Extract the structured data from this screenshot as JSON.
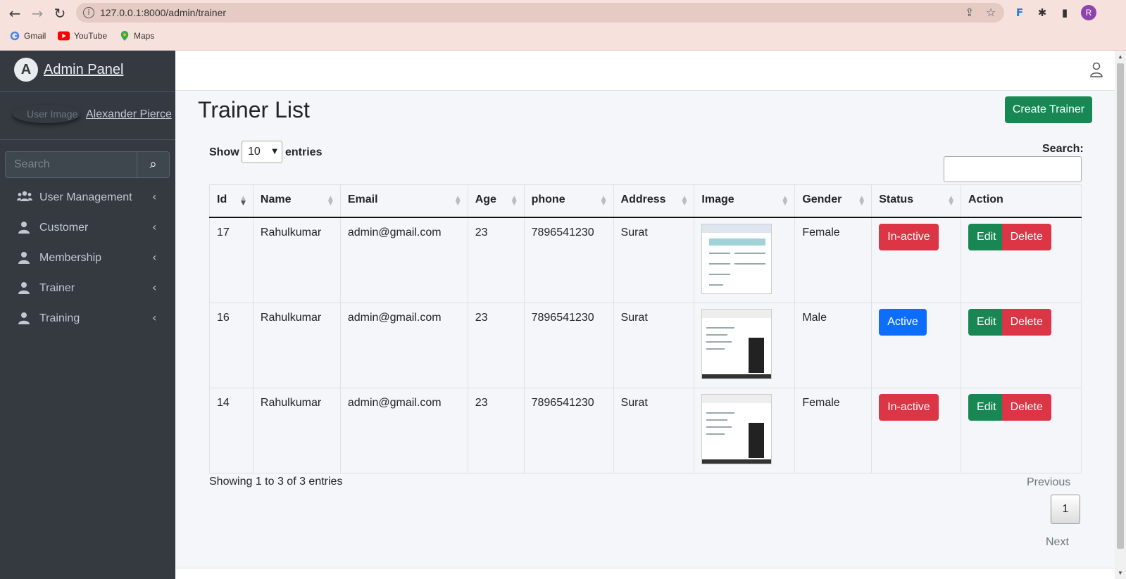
{
  "browser": {
    "url": "127.0.0.1:8000/admin/trainer",
    "profile_initial": "R",
    "bookmarks": [
      {
        "label": "Gmail",
        "icon": "google-icon"
      },
      {
        "label": "YouTube",
        "icon": "youtube-icon"
      },
      {
        "label": "Maps",
        "icon": "maps-icon"
      }
    ]
  },
  "sidebar": {
    "brand": "Admin Panel",
    "brand_logo": "A",
    "user_image_alt": "User Image",
    "user_name": "Alexander Pierce",
    "search_placeholder": "Search",
    "items": [
      {
        "label": "User Management",
        "icon": "users-icon"
      },
      {
        "label": "Customer",
        "icon": "user-icon"
      },
      {
        "label": "Membership",
        "icon": "user-icon"
      },
      {
        "label": "Trainer",
        "icon": "user-icon"
      },
      {
        "label": "Training",
        "icon": "user-icon"
      }
    ]
  },
  "main": {
    "title": "Trainer List",
    "create_button": "Create Trainer",
    "show_label": "Show",
    "length_value": "10",
    "entries_label": "entries",
    "search_label": "Search:",
    "columns": [
      "Id",
      "Name",
      "Email",
      "Age",
      "phone",
      "Address",
      "Image",
      "Gender",
      "Status",
      "Action"
    ],
    "rows": [
      {
        "id": "17",
        "name": "Rahulkumar",
        "email": "admin@gmail.com",
        "age": "23",
        "phone": "7896541230",
        "address": "Surat",
        "gender": "Female",
        "status": "In-active",
        "status_color": "#dc3545"
      },
      {
        "id": "16",
        "name": "Rahulkumar",
        "email": "admin@gmail.com",
        "age": "23",
        "phone": "7896541230",
        "address": "Surat",
        "gender": "Male",
        "status": "Active",
        "status_color": "#0d6efd"
      },
      {
        "id": "14",
        "name": "Rahulkumar",
        "email": "admin@gmail.com",
        "age": "23",
        "phone": "7896541230",
        "address": "Surat",
        "gender": "Female",
        "status": "In-active",
        "status_color": "#dc3545"
      }
    ],
    "edit_label": "Edit",
    "delete_label": "Delete",
    "info": "Showing 1 to 3 of 3 entries",
    "prev_label": "Previous",
    "page": "1",
    "next_label": "Next"
  },
  "colors": {
    "sidebar": "#343a40",
    "primary": "#0d6efd",
    "success": "#198754",
    "danger": "#dc3545"
  }
}
